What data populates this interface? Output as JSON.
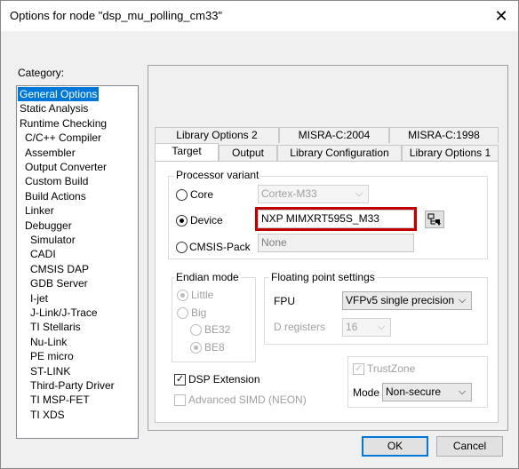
{
  "window": {
    "title": "Options for node \"dsp_mu_polling_cm33\"",
    "close_glyph": "✕"
  },
  "category": {
    "label": "Category:",
    "items": [
      "General Options",
      "Static Analysis",
      "Runtime Checking",
      "C/C++ Compiler",
      "Assembler",
      "Output Converter",
      "Custom Build",
      "Build Actions",
      "Linker",
      "Debugger",
      "Simulator",
      "CADI",
      "CMSIS DAP",
      "GDB Server",
      "I-jet",
      "J-Link/J-Trace",
      "TI Stellaris",
      "Nu-Link",
      "PE micro",
      "ST-LINK",
      "Third-Party Driver",
      "TI MSP-FET",
      "TI XDS"
    ],
    "selected": "General Options"
  },
  "tabs": {
    "back_row": [
      "Library Options 2",
      "MISRA-C:2004",
      "MISRA-C:1998"
    ],
    "front_row": [
      "Target",
      "Output",
      "Library Configuration",
      "Library Options 1"
    ],
    "active": "Target"
  },
  "processor_variant": {
    "label": "Processor variant",
    "core_label": "Core",
    "core_value": "Cortex-M33",
    "device_label": "Device",
    "device_value": "NXP MIMXRT595S_M33",
    "cmsis_label": "CMSIS-Pack",
    "cmsis_value": "None",
    "selected": "Device"
  },
  "endian": {
    "label": "Endian mode",
    "little": "Little",
    "big": "Big",
    "be32": "BE32",
    "be8": "BE8"
  },
  "fp": {
    "label": "Floating point settings",
    "fpu_label": "FPU",
    "fpu_value": "VFPv5 single precision",
    "dreg_label": "D registers",
    "dreg_value": "16"
  },
  "dsp_extension": {
    "label": "DSP Extension",
    "checked": true
  },
  "advanced_simd": {
    "label": "Advanced SIMD (NEON)",
    "checked": false
  },
  "trustzone": {
    "label": "TrustZone",
    "checked": true,
    "mode_label": "Mode",
    "mode_value": "Non-secure"
  },
  "buttons": {
    "ok": "OK",
    "cancel": "Cancel"
  },
  "glyphs": {
    "dropdown_arrow": "⌵",
    "check": "✓"
  },
  "colors": {
    "selection": "#0078d7",
    "highlight_box": "#c00000"
  }
}
